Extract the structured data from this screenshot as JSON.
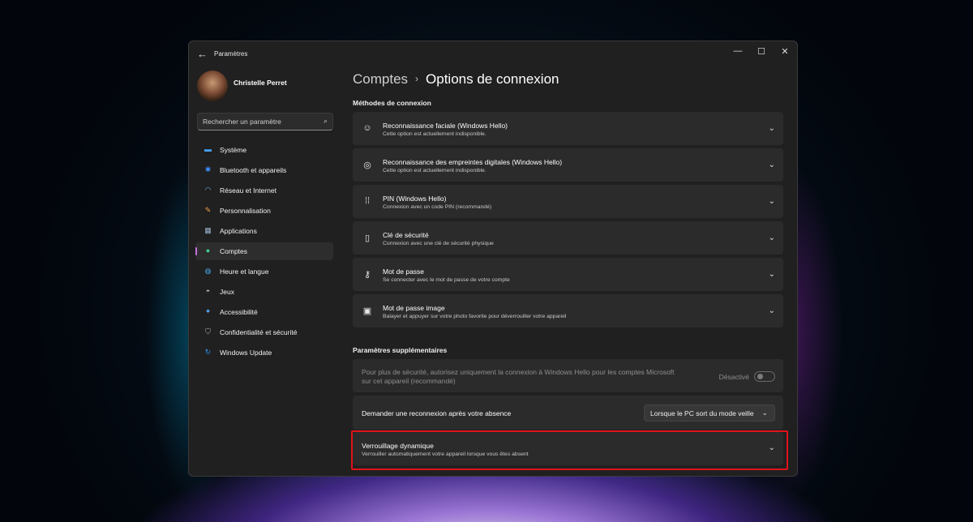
{
  "window": {
    "title": "Paramètres",
    "back_icon": "←",
    "controls": {
      "minimize": "—",
      "maximize": "☐",
      "close": "✕"
    }
  },
  "profile": {
    "name": "Christelle Perret"
  },
  "search": {
    "placeholder": "Rechercher un paramètre"
  },
  "sidebar": {
    "items": [
      {
        "label": "Système",
        "icon": "system-icon",
        "glyph": "▬",
        "color": "#4aa3ff"
      },
      {
        "label": "Bluetooth et appareils",
        "icon": "bluetooth-icon",
        "glyph": "✱",
        "color": "#3d8bfd"
      },
      {
        "label": "Réseau et Internet",
        "icon": "wifi-icon",
        "glyph": "◠",
        "color": "#6fb6ff"
      },
      {
        "label": "Personnalisation",
        "icon": "brush-icon",
        "glyph": "✎",
        "color": "#f0a046"
      },
      {
        "label": "Applications",
        "icon": "apps-icon",
        "glyph": "▦",
        "color": "#9ab0c8"
      },
      {
        "label": "Comptes",
        "icon": "accounts-icon",
        "glyph": "●",
        "color": "#3ccf8e",
        "active": true
      },
      {
        "label": "Heure et langue",
        "icon": "globe-icon",
        "glyph": "◍",
        "color": "#48a9f0"
      },
      {
        "label": "Jeux",
        "icon": "gamepad-icon",
        "glyph": "◓",
        "color": "#b9b9b9"
      },
      {
        "label": "Accessibilité",
        "icon": "accessibility-icon",
        "glyph": "✦",
        "color": "#58a7ff"
      },
      {
        "label": "Confidentialité et sécurité",
        "icon": "shield-icon",
        "glyph": "⛉",
        "color": "#a8b4c0"
      },
      {
        "label": "Windows Update",
        "icon": "update-icon",
        "glyph": "↻",
        "color": "#2f8fe8"
      }
    ]
  },
  "breadcrumb": {
    "parent": "Comptes",
    "separator": "›",
    "current": "Options de connexion"
  },
  "sections": {
    "methods_title": "Méthodes de connexion",
    "additional_title": "Paramètres supplémentaires"
  },
  "methods": [
    {
      "title": "Reconnaissance faciale (Windows Hello)",
      "desc": "Cette option est actuellement indisponible.",
      "icon": "face-icon",
      "glyph": "☺"
    },
    {
      "title": "Reconnaissance des empreintes digitales (Windows Hello)",
      "desc": "Cette option est actuellement indisponible.",
      "icon": "fingerprint-icon",
      "glyph": "◎"
    },
    {
      "title": "PIN (Windows Hello)",
      "desc": "Connexion avec un code PIN (recommandé)",
      "icon": "pin-icon",
      "glyph": "⁞⁞"
    },
    {
      "title": "Clé de sécurité",
      "desc": "Connexion avec une clé de sécurité physique",
      "icon": "key-usb-icon",
      "glyph": "▯"
    },
    {
      "title": "Mot de passe",
      "desc": "Se connecter avec le mot de passe de votre compte",
      "icon": "key-icon",
      "glyph": "⚷"
    },
    {
      "title": "Mot de passe image",
      "desc": "Balayer et appuyer sur votre photo favorite pour déverrouiller votre appareil",
      "icon": "image-icon",
      "glyph": "▣"
    }
  ],
  "additional": {
    "hello_only": {
      "text_line1": "Pour plus de sécurité, autorisez uniquement la connexion à Windows Hello pour les comptes Microsoft",
      "text_line2": "sur cet appareil (recommandé)",
      "toggle_label": "Désactivé",
      "toggle_on": false
    },
    "reconnect": {
      "label": "Demander une reconnexion après votre absence",
      "dropdown_value": "Lorsque le PC sort du mode veille"
    },
    "dynamic_lock": {
      "title": "Verrouillage dynamique",
      "desc": "Verrouiller automatiquement votre appareil lorsque vous êtes absent"
    }
  },
  "chevron": "⌄",
  "accent_color": "#c86fe0",
  "highlight_color": "#e0121b"
}
